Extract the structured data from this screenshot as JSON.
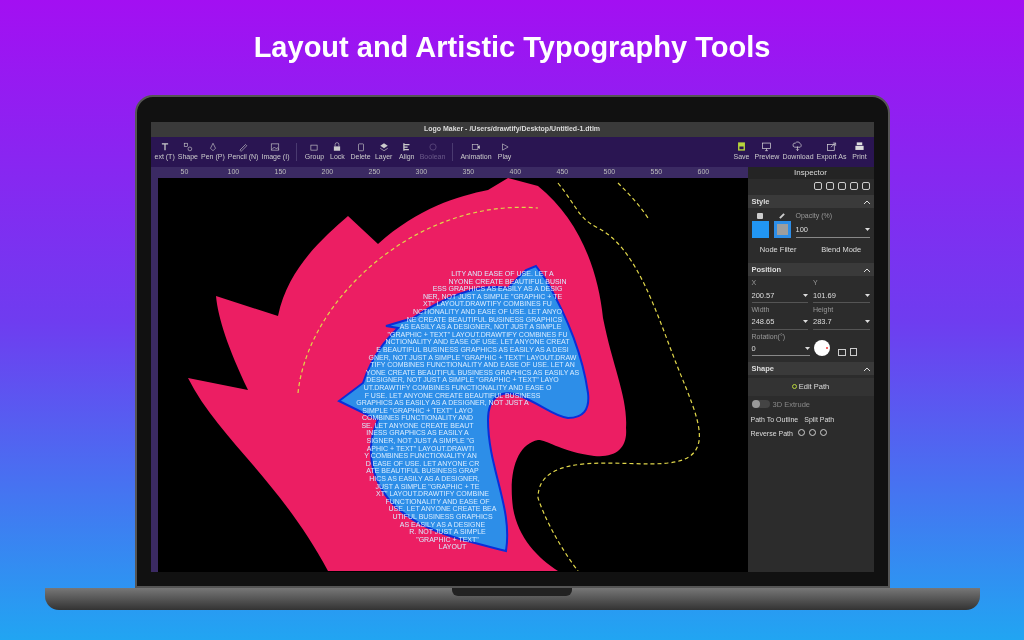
{
  "headline": "Layout and Artistic Typography Tools",
  "window": {
    "title": "Logo Maker - /Users/drawtify/Desktop/Untitled-1.dtlm"
  },
  "toolbar": {
    "tools": [
      {
        "label": "ext (T)"
      },
      {
        "label": "Shape"
      },
      {
        "label": "Pen (P)"
      },
      {
        "label": "Pencil (N)"
      },
      {
        "label": "Image (I)"
      },
      {
        "label": "Group"
      },
      {
        "label": "Lock"
      },
      {
        "label": "Delete"
      },
      {
        "label": "Layer"
      },
      {
        "label": "Align"
      },
      {
        "label": "Boolean",
        "disabled": true
      },
      {
        "label": "Animation"
      },
      {
        "label": "Play"
      }
    ],
    "actions": [
      {
        "label": "Save"
      },
      {
        "label": "Preview"
      },
      {
        "label": "Download"
      },
      {
        "label": "Export As"
      },
      {
        "label": "Print"
      }
    ]
  },
  "ruler": [
    "50",
    "100",
    "150",
    "200",
    "250",
    "300",
    "350",
    "400",
    "450",
    "500",
    "550",
    "600"
  ],
  "canvas": {
    "text_lines": [
      "LITY AND EASE OF USE. LET A",
      "NYONE CREATE BEAUTIFUL BUSIN",
      "ESS GRAPHICS AS EASILY AS A DESIG",
      "NER, NOT JUST A SIMPLE \"GRAPHIC + TE",
      "XT\" LAYOUT.DRAWTIFY COMBINES FU",
      "NCTIONALITY AND EASE OF USE. LET ANYO",
      "NE CREATE BEAUTIFUL BUSINESS GRAPHICS",
      "AS EASILY AS A DESIGNER, NOT JUST A SIMPLE",
      "\"GRAPHIC + TEXT\" LAYOUT.DRAWTIFY COMBINES FU",
      "NCTIONALITY AND EASE OF USE. LET ANYONE CREAT",
      "E BEAUTIFUL BUSINESS GRAPHICS AS EASILY AS A DESI",
      "GNER, NOT JUST A SIMPLE \"GRAPHIC + TEXT\" LAYOUT.DRAW",
      "TIFY COMBINES FUNCTIONALITY AND EASE OF USE. LET AN",
      "YONE CREATE BEAUTIFUL BUSINESS GRAPHICS AS EASILY AS",
      "DESIGNER, NOT JUST A SIMPLE \"GRAPHIC + TEXT\" LAYO",
      "UT.DRAWTIFY COMBINES FUNCTIONALITY AND EASE O",
      "F USE. LET ANYONE CREATE BEAUTIFUL BUSINESS",
      "GRAPHICS AS EASILY AS A DESIGNER, NOT JUST A",
      "SIMPLE \"GRAPHIC + TEXT\" LAYO",
      "COMBINES FUNCTIONALITY AND",
      "SE. LET ANYONE CREATE BEAUT",
      "INESS GRAPHICS AS EASILY A",
      "SIGNER, NOT JUST A SIMPLE \"G",
      "APHIC + TEXT\" LAYOUT.DRAWTI",
      "Y COMBINES FUNCTIONALITY AN",
      "D EASE OF USE. LET ANYONE CR",
      "ATE BEAUTIFUL BUSINESS GRAP",
      "HICS AS EASILY AS A DESIGNER,",
      "JUST A SIMPLE \"GRAPHIC + TE",
      "XT\" LAYOUT.DRAWTIFY COMBINE",
      "FUNCTIONALITY AND EASE OF",
      "USE. LET ANYONE CREATE BEA",
      "UTIFUL BUSINESS GRAPHICS",
      "AS EASILY AS A DESIGNE",
      "R. NOT JUST A SIMPLE",
      "\"GRAPHIC + TEXT\"",
      "LAYOUT"
    ]
  },
  "inspector": {
    "title": "Inspector",
    "style": {
      "title": "Style",
      "opacity_label": "Opacity (%)",
      "opacity": "100",
      "buttons": [
        "Node Filter",
        "Blend Mode"
      ]
    },
    "position": {
      "title": "Position",
      "fields": [
        {
          "label": "X",
          "value": "200.57"
        },
        {
          "label": "Y",
          "value": "101.69"
        },
        {
          "label": "Width",
          "value": "248.65"
        },
        {
          "label": "Height",
          "value": "283.7"
        }
      ],
      "rotation_label": "Rotation(°)",
      "rotation": "0"
    },
    "shape": {
      "title": "Shape",
      "edit_path": "Edit Path",
      "extrude": {
        "label": "3D Extrude",
        "on": false
      },
      "buttons": [
        "Path To Outline",
        "Split Path",
        "Reverse Path"
      ]
    }
  }
}
